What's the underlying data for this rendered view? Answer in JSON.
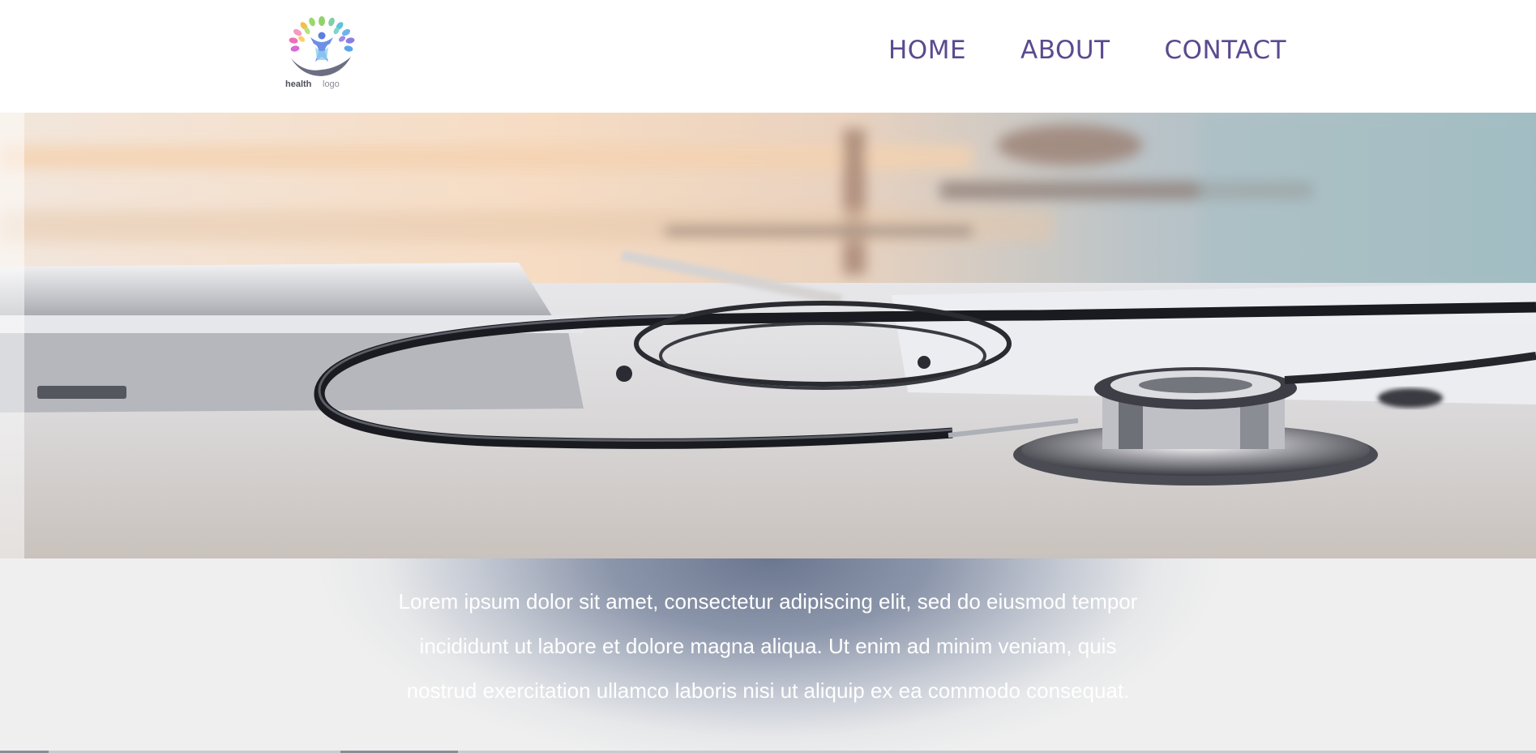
{
  "header": {
    "logo": {
      "icon": "tree-person-hand-logo",
      "wordmark_bold": "health",
      "wordmark_light": "logo"
    },
    "nav": {
      "items": [
        {
          "label": "HOME"
        },
        {
          "label": "ABOUT"
        },
        {
          "label": "CONTACT"
        }
      ]
    }
  },
  "hero": {
    "image": "stethoscope-on-desk-photo"
  },
  "intro": {
    "text": "Lorem ipsum dolor sit amet, consectetur adipiscing elit, sed do eiusmod tempor incididunt ut labore et dolore magna aliqua. Ut enim ad minim veniam, quis nostrud exercitation ullamco laboris nisi ut aliquip ex ea commodo consequat."
  },
  "colors": {
    "nav_text": "#5a4a8f",
    "band_center": "#6b7790",
    "band_edge": "#efefef",
    "body_text": "#ffffff"
  }
}
